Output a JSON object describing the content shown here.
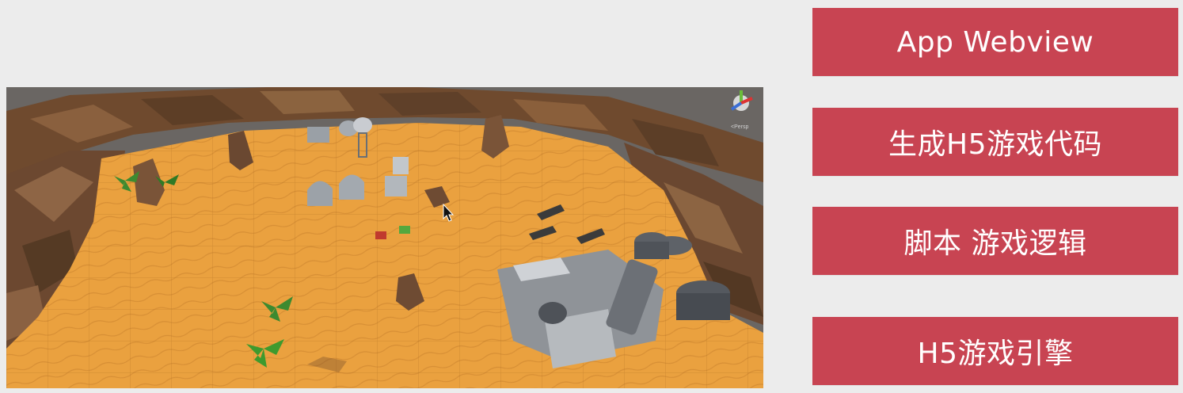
{
  "viewport": {
    "view_label": "<Persp",
    "colors": {
      "sand": "#eaa13f",
      "rock": "#7a5638",
      "sky": "#6f6a66"
    }
  },
  "stack": {
    "items": [
      {
        "label": "App Webview",
        "color": "#c84452"
      },
      {
        "label": "生成H5游戏代码",
        "color": "#c84452"
      },
      {
        "label": "脚本 游戏逻辑",
        "color": "#c84452"
      },
      {
        "label": "H5游戏引擎",
        "color": "#c84452"
      }
    ]
  }
}
